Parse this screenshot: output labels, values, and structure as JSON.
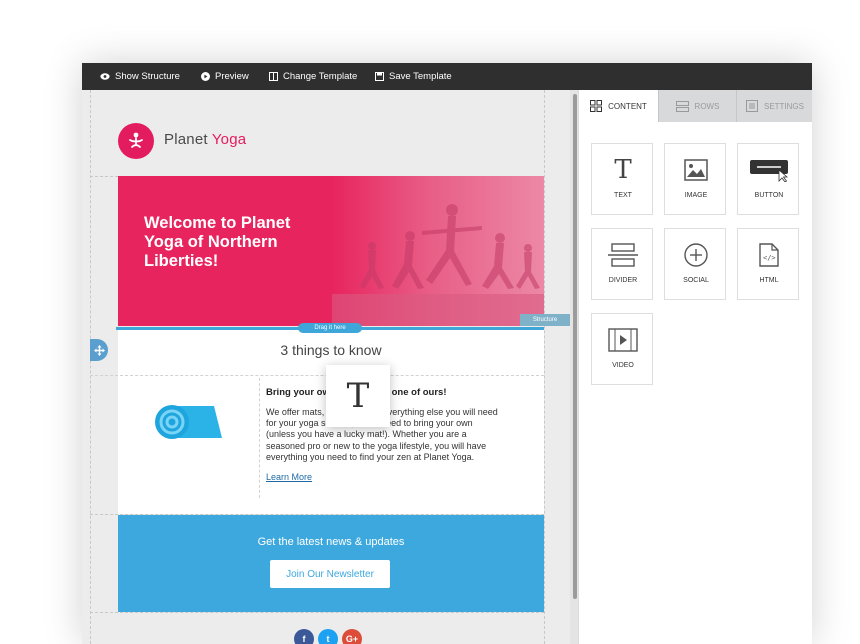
{
  "toolbar": {
    "show_structure": "Show Structure",
    "preview": "Preview",
    "change_template": "Change Template",
    "save_template": "Save Template"
  },
  "email": {
    "brand_first": "Planet",
    "brand_second": "Yoga",
    "hero_title": "Welcome to Planet Yoga of Northern Liberties!",
    "structure_tag": "Structure",
    "drag_hint": "Drag it here",
    "section_title": "3 things to know",
    "item_title": "Bring your own mat, or use one of ours!",
    "item_body": "We offer mats, blankets, and everything else you will need for your yoga session, so no need to bring your own (unless you have a lucky mat!). Whether you are a seasoned pro or new to the yoga lifestyle, you will have everything you need to find your zen at Planet Yoga.",
    "learn_more": "Learn More",
    "newsletter_title": "Get the latest news & updates",
    "newsletter_button": "Join Our Newsletter",
    "social": [
      "f",
      "t",
      "G+"
    ]
  },
  "sidebar": {
    "tabs": [
      "CONTENT",
      "ROWS",
      "SETTINGS"
    ],
    "active_tab": "CONTENT",
    "blocks": [
      "TEXT",
      "IMAGE",
      "BUTTON",
      "DIVIDER",
      "SOCIAL",
      "HTML",
      "VIDEO"
    ]
  },
  "drag_ghost": "T",
  "colors": {
    "brand_pink": "#e31c5f",
    "newsletter_blue": "#3da8de",
    "toolbar_bg": "#2f2f2f"
  }
}
